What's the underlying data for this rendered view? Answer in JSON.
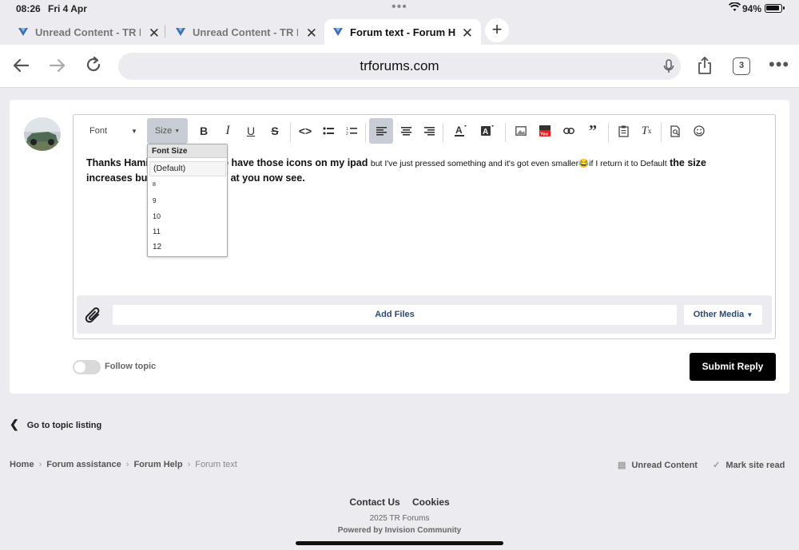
{
  "status": {
    "time": "08:26",
    "date": "Fri 4 Apr",
    "battery": "94%"
  },
  "tabs": [
    {
      "title": "Unread Content - TR Forums",
      "active": false
    },
    {
      "title": "Unread Content - TR Forums",
      "active": false
    },
    {
      "title": "Forum text - Forum Help",
      "active": true
    }
  ],
  "toolbar": {
    "url": "trforums.com",
    "tab_count": "3"
  },
  "editor": {
    "font_label": "Font",
    "size_label": "Size",
    "text_line1_a": "Thanks Hamis",
    "text_line1_b": " to have those icons on my ipad ",
    "text_line1_small": "but I've just pressed something and it's got even smaller😂if I return it to Default",
    "text_line1_c": " the size",
    "text_line2_a": "increases but",
    "text_line2_b": "at you now see.",
    "dropdown": {
      "header": "Font Size",
      "options": [
        "(Default)",
        "8",
        "9",
        "10",
        "11",
        "12"
      ]
    },
    "add_files": "Add Files",
    "other_media": "Other Media"
  },
  "follow_topic": "Follow topic",
  "submit": "Submit Reply",
  "goto_listing": "Go to topic listing",
  "breadcrumb": [
    "Home",
    "Forum assistance",
    "Forum Help",
    "Forum text"
  ],
  "right_links": {
    "unread": "Unread Content",
    "mark_read": "Mark site read"
  },
  "footer": {
    "contact": "Contact Us",
    "cookies": "Cookies",
    "copyright": "2025 TR Forums",
    "powered": "Powered by Invision Community"
  }
}
